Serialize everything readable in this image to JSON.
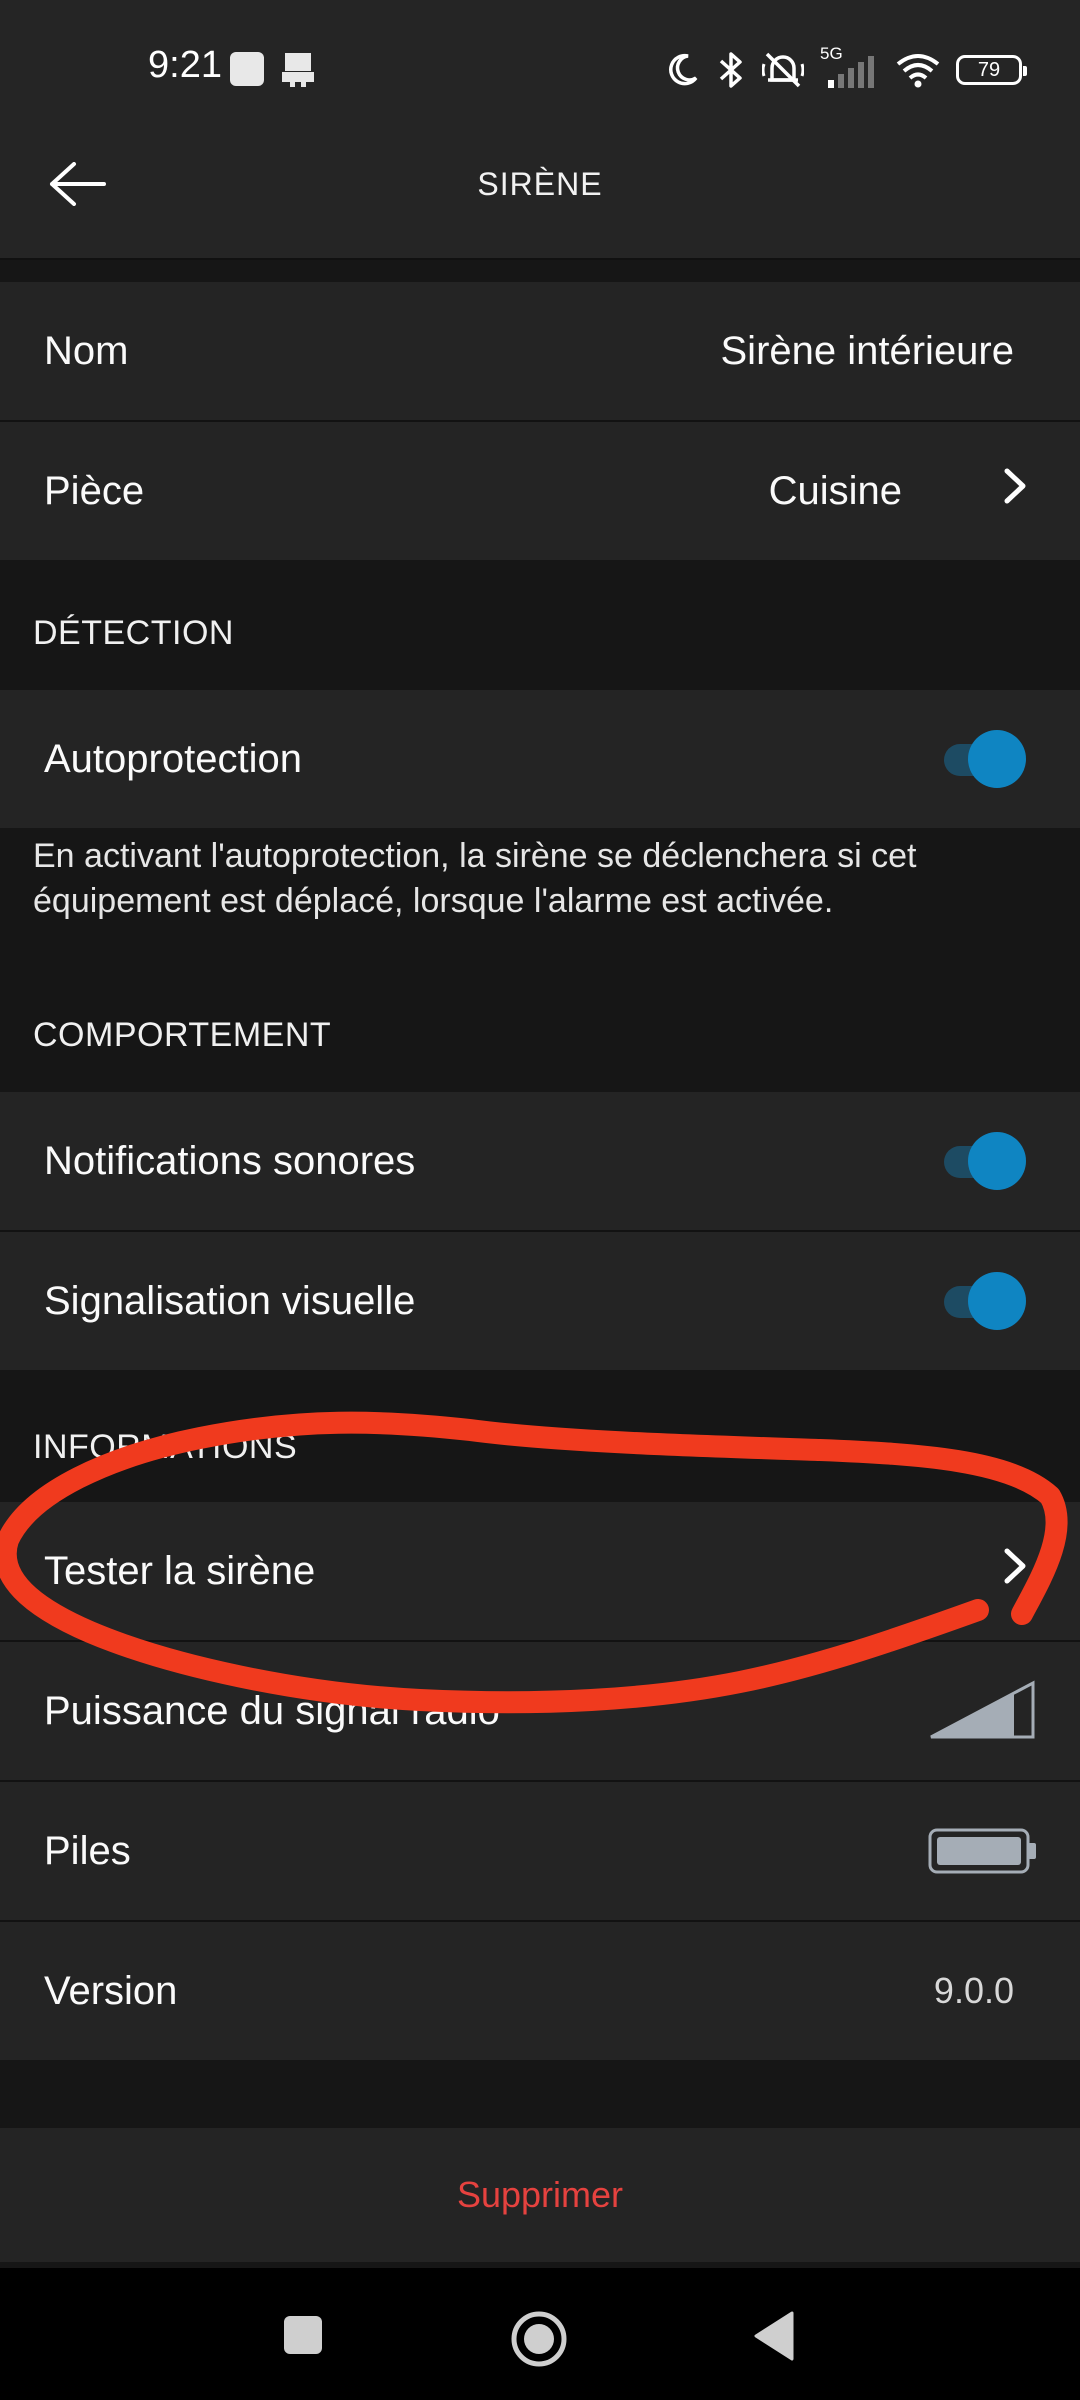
{
  "status_bar": {
    "time": "9:21",
    "network_label": "5G",
    "battery_level": "79"
  },
  "header": {
    "title": "SIRÈNE",
    "back_icon": "arrow-left-icon"
  },
  "rows": {
    "nom": {
      "label": "Nom",
      "value": "Sirène intérieure"
    },
    "piece": {
      "label": "Pièce",
      "value": "Cuisine"
    }
  },
  "sections": {
    "detection": {
      "title": "DÉTECTION",
      "autoprotection": {
        "label": "Autoprotection",
        "enabled": true
      },
      "help_text": "En activant l'autoprotection, la sirène se déclenchera si cet équipement est déplacé, lorsque l'alarme est activée."
    },
    "comportement": {
      "title": "COMPORTEMENT",
      "notifications": {
        "label": "Notifications sonores",
        "enabled": true
      },
      "signalisation": {
        "label": "Signalisation visuelle",
        "enabled": true
      }
    },
    "informations": {
      "title": "INFORMATIONS",
      "tester": {
        "label": "Tester la sirène"
      },
      "signal": {
        "label": "Puissance du signal radio",
        "icon": "signal-strength-icon"
      },
      "piles": {
        "label": "Piles",
        "icon": "battery-full-icon"
      },
      "version": {
        "label": "Version",
        "value": "9.0.0"
      }
    }
  },
  "delete_label": "Supprimer",
  "colors": {
    "accent_toggle": "#0f85c2",
    "danger": "#e5423f",
    "annotation": "#f03a1e",
    "row_bg": "#242424",
    "page_bg": "#161616"
  }
}
